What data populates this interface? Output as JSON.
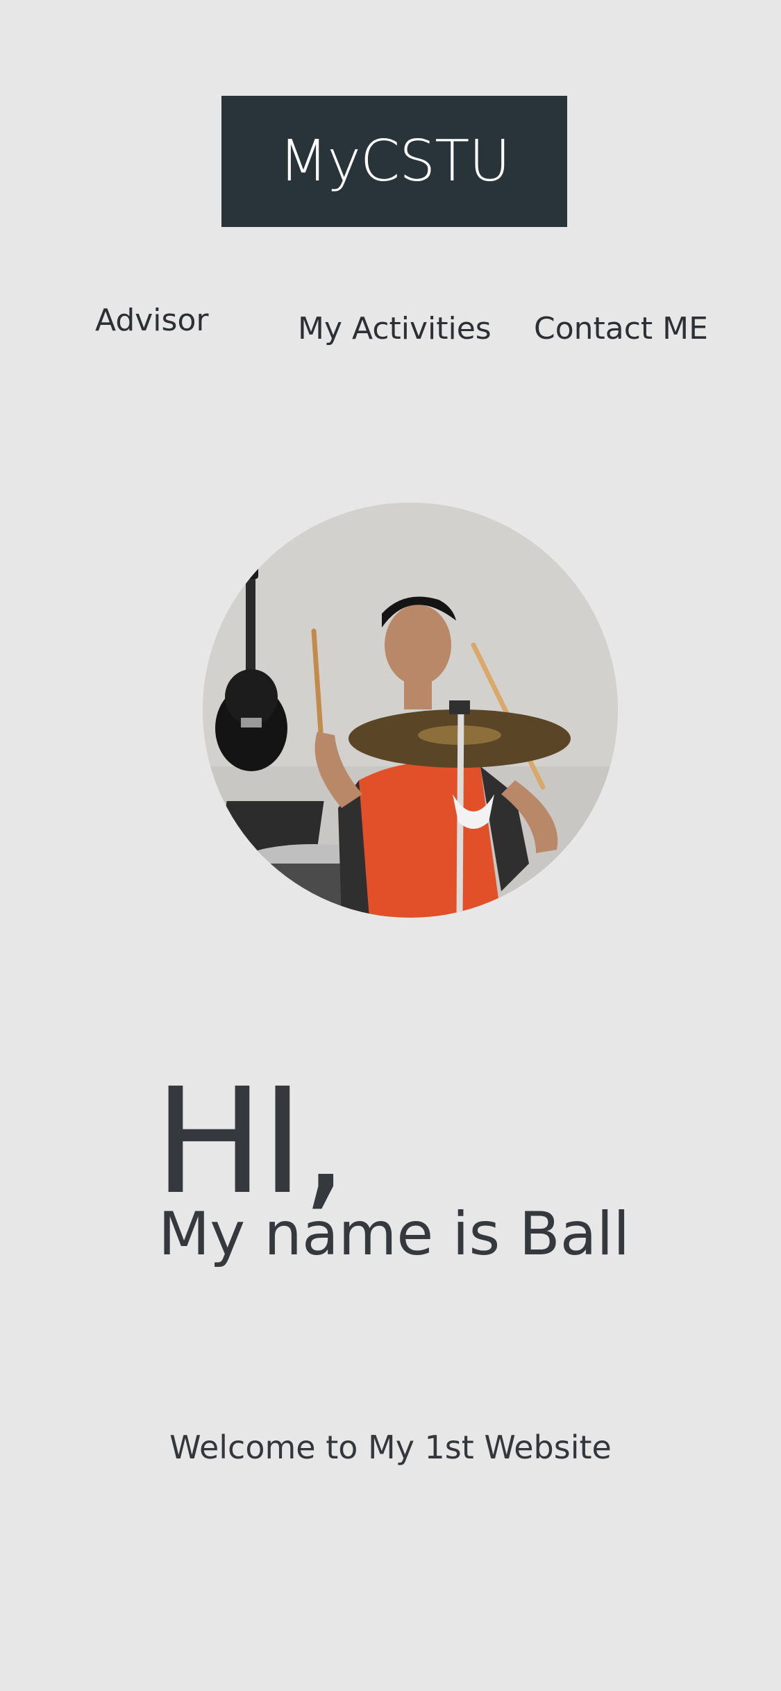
{
  "header": {
    "logo_text": "MyCSTU"
  },
  "nav": {
    "items": [
      {
        "label": "Advisor"
      },
      {
        "label": "My Activities"
      },
      {
        "label": "Contact ME"
      }
    ]
  },
  "profile": {
    "photo_icon": "drummer-photo"
  },
  "hero": {
    "greeting": "HI,",
    "name_line": "My name is Ball"
  },
  "welcome": {
    "text": "Welcome to My 1st Website"
  },
  "colors": {
    "background": "#e7e7e7",
    "logo_background": "#28333a",
    "text": "#35393e"
  }
}
